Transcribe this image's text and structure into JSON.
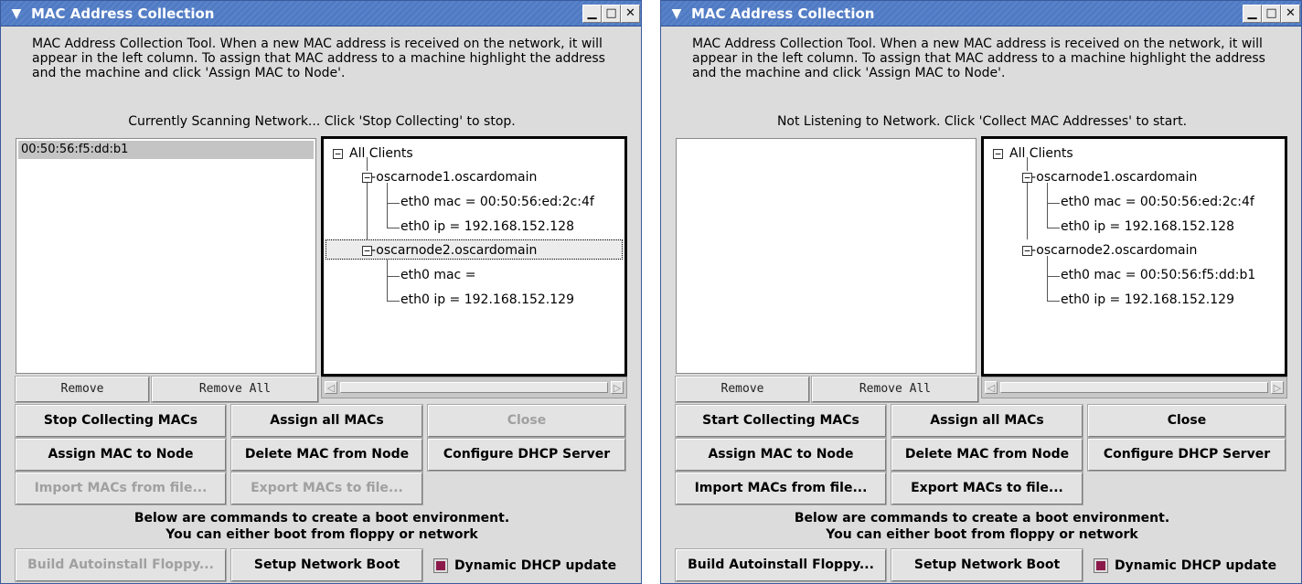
{
  "windows": [
    {
      "title": "MAC Address Collection",
      "description": "MAC Address Collection Tool.  When a new MAC address is received on the network, it will appear in the left column.  To assign that MAC address to a machine highlight the address and the machine and click 'Assign MAC to Node'.",
      "status": "Currently Scanning Network... Click 'Stop Collecting' to stop.",
      "mac_list": [
        "00:50:56:f5:dd:b1"
      ],
      "tree": {
        "root": "All Clients",
        "nodes": [
          {
            "name": "-oscarnode1.oscardomain",
            "mac": "eth0 mac = 00:50:56:ed:2c:4f",
            "ip": "eth0 ip = 192.168.152.128"
          },
          {
            "name": "-oscarnode2.oscardomain",
            "mac": "eth0 mac = ",
            "ip": "eth0 ip = 192.168.152.129"
          }
        ],
        "selected_node": 1
      },
      "buttons": {
        "remove": "Remove",
        "remove_all": "Remove All",
        "collect": "Stop Collecting MACs",
        "assign_all": "Assign all MACs",
        "close": "Close",
        "assign": "Assign MAC to Node",
        "delete": "Delete MAC from Node",
        "dhcp": "Configure DHCP Server",
        "import": "Import MACs from file...",
        "export": "Export MACs to file...",
        "floppy": "Build Autoinstall Floppy...",
        "netboot": "Setup Network Boot"
      },
      "disabled": {
        "close": true,
        "import": true,
        "export": true,
        "floppy": true
      },
      "boot_info_line1": "Below are commands to create a boot environment.",
      "boot_info_line2": "You can either boot from floppy or network",
      "dynamic_dhcp_label": "Dynamic DHCP update",
      "dynamic_dhcp_checked": true
    },
    {
      "title": "MAC Address Collection",
      "description": "MAC Address Collection Tool.  When a new MAC address is received on the network, it will appear in the left column.  To assign that MAC address to a machine highlight the address and the machine and click 'Assign MAC to Node'.",
      "status": "Not Listening to Network. Click 'Collect MAC Addresses' to start.",
      "mac_list": [],
      "tree": {
        "root": "All Clients",
        "nodes": [
          {
            "name": "-oscarnode1.oscardomain",
            "mac": "eth0 mac = 00:50:56:ed:2c:4f",
            "ip": "eth0 ip = 192.168.152.128"
          },
          {
            "name": "-oscarnode2.oscardomain",
            "mac": "eth0 mac = 00:50:56:f5:dd:b1",
            "ip": "eth0 ip = 192.168.152.129"
          }
        ],
        "selected_node": null
      },
      "buttons": {
        "remove": "Remove",
        "remove_all": "Remove All",
        "collect": "Start Collecting MACs",
        "assign_all": "Assign all MACs",
        "close": "Close",
        "assign": "Assign MAC to Node",
        "delete": "Delete MAC from Node",
        "dhcp": "Configure DHCP Server",
        "import": "Import MACs from file...",
        "export": "Export MACs to file...",
        "floppy": "Build Autoinstall Floppy...",
        "netboot": "Setup Network Boot"
      },
      "disabled": {
        "close": false,
        "import": false,
        "export": false,
        "floppy": false
      },
      "boot_info_line1": "Below are commands to create a boot environment.",
      "boot_info_line2": "You can either boot from floppy or network",
      "dynamic_dhcp_label": "Dynamic DHCP update",
      "dynamic_dhcp_checked": true
    }
  ],
  "icons": {
    "window_menu": "chevron-down-icon",
    "minimize": "minimize-icon",
    "maximize": "maximize-icon",
    "close": "close-icon",
    "tree_expander": "minus-box-icon",
    "scroll_left": "arrow-left-icon",
    "scroll_right": "arrow-right-icon"
  },
  "colors": {
    "titlebar": "#4f7ac4",
    "window_bg": "#dcdcdc",
    "checkbox_checked": "#8b1a4a",
    "selected_row": "#c4c4c4"
  }
}
